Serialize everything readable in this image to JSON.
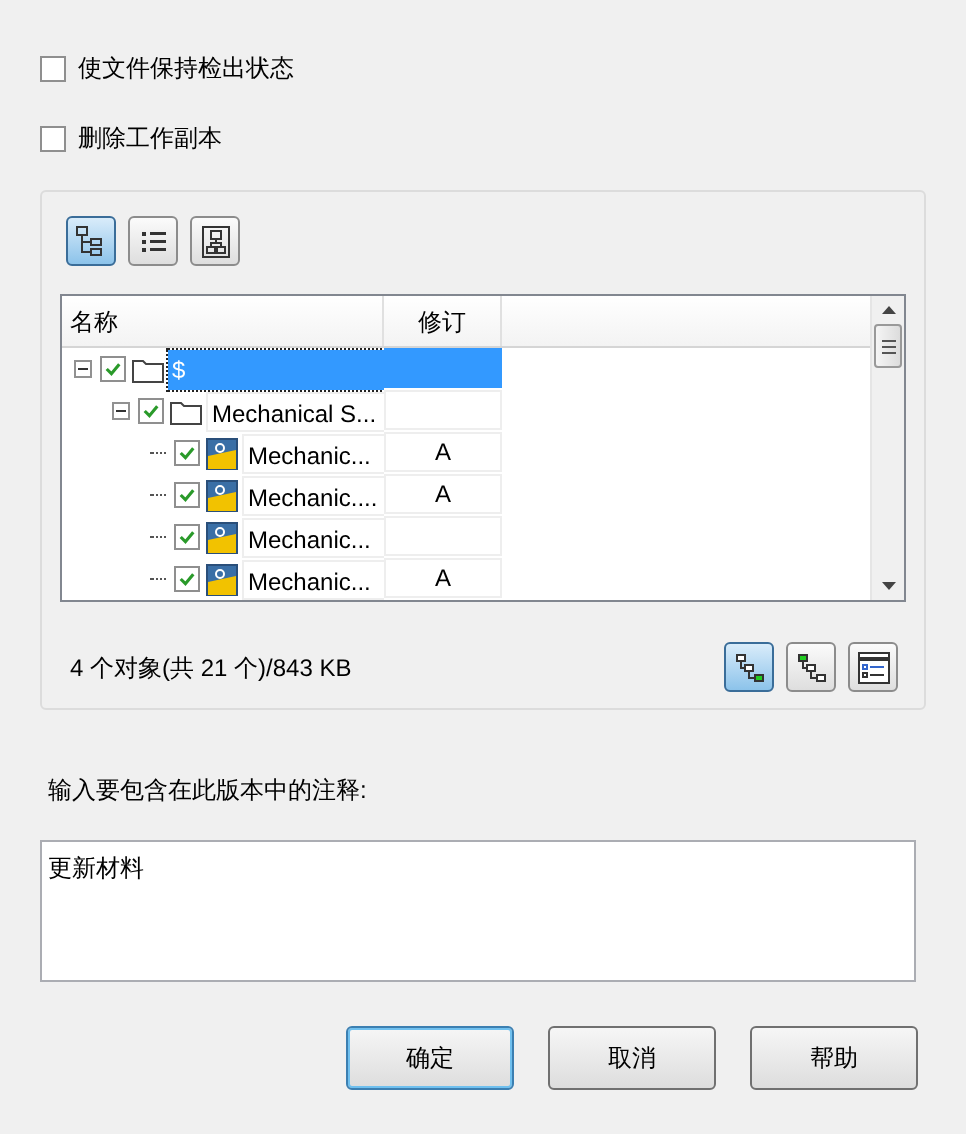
{
  "options": [
    {
      "label": "使文件保持检出状态",
      "checked": false
    },
    {
      "label": "删除工作副本",
      "checked": false
    }
  ],
  "view_buttons": [
    {
      "kind": "tree",
      "selected": true
    },
    {
      "kind": "list",
      "selected": false
    },
    {
      "kind": "hierarchy",
      "selected": false
    }
  ],
  "tree": {
    "columns": [
      "名称",
      "修订"
    ],
    "items": [
      {
        "name": "$",
        "kind": "folder",
        "checked": true,
        "expanded": true,
        "selected": true,
        "children": [
          {
            "name": "Mechanical S...",
            "kind": "folder",
            "checked": true,
            "expanded": true,
            "selected": false,
            "children": [
              {
                "name": "Mechanic...",
                "kind": "file",
                "checked": true,
                "selected": false,
                "revision": "A"
              },
              {
                "name": "Mechanic....",
                "kind": "file",
                "checked": true,
                "selected": false,
                "revision": "A"
              },
              {
                "name": "Mechanic...",
                "kind": "file",
                "checked": true,
                "selected": false
              },
              {
                "name": "Mechanic...",
                "kind": "file",
                "checked": true,
                "selected": false,
                "revision": "A"
              }
            ]
          }
        ]
      }
    ]
  },
  "summary": "4 个对象(共 21 个)/843 KB",
  "display_buttons": [
    {
      "kind": "tree-selected",
      "selected": true
    },
    {
      "kind": "tree-parent",
      "selected": false
    },
    {
      "kind": "details",
      "selected": false
    }
  ],
  "comment": {
    "label": "输入要包含在此版本中的注释:",
    "value": "更新材料"
  },
  "buttons": [
    {
      "label": "确定",
      "default": true
    },
    {
      "label": "取消",
      "default": false
    },
    {
      "label": "帮助",
      "default": false
    }
  ]
}
